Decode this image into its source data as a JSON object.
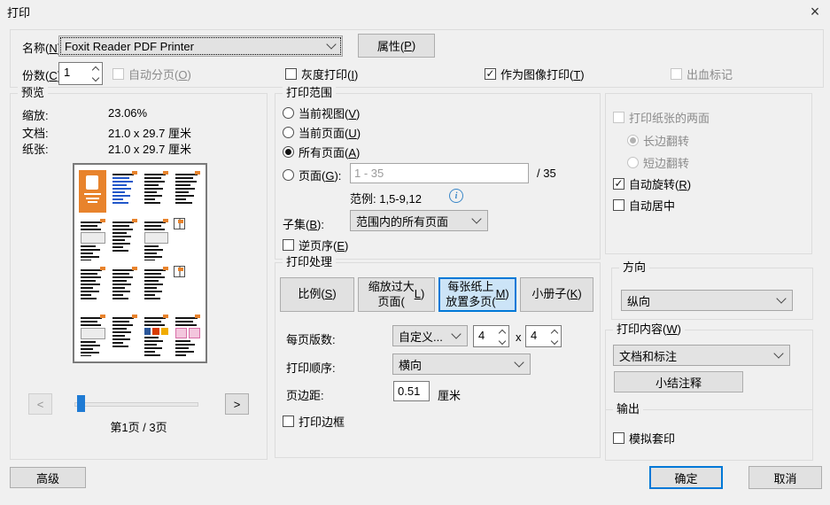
{
  "dialog": {
    "title": "打印",
    "close_icon": "×"
  },
  "printer_section": {
    "name_label": "名称(N):",
    "printer_name": "Foxit Reader PDF Printer",
    "properties_button": "属性(P)",
    "copies_label": "份数(C):",
    "copies_value": "1",
    "collate_checkbox": "自动分页(O)",
    "grayscale_checkbox": "灰度打印(I)",
    "print_as_image_checkbox": "作为图像打印(T)",
    "bleed_marks_checkbox": "出血标记"
  },
  "preview": {
    "group_title": "预览",
    "zoom_label": "缩放:",
    "zoom_value": "23.06%",
    "document_label": "文档:",
    "document_value": "21.0 x 29.7 厘米",
    "paper_label": "纸张:",
    "paper_value": "21.0 x 29.7 厘米",
    "prev_button": "<",
    "next_button": ">",
    "page_indicator": "第1页 / 3页",
    "thumbnail": {
      "rows": 4,
      "cols": 4,
      "cells": [
        "cover",
        "toc",
        "text",
        "text",
        "shot",
        "text",
        "shot",
        "box",
        "text",
        "text",
        "text",
        "box",
        "shot",
        "text",
        "word",
        "pics"
      ],
      "cover_color": "#e8832c"
    }
  },
  "print_range": {
    "group_title": "打印范围",
    "current_view_radio": "当前视图(V)",
    "current_page_radio": "当前页面(U)",
    "all_pages_radio": "所有页面(A)",
    "pages_radio": "页面(G):",
    "pages_value": "1 - 35",
    "pages_total": "/ 35",
    "example_text": "范例: 1,5-9,12",
    "info_icon": "i",
    "subset_label": "子集(B):",
    "subset_value": "范围内的所有页面",
    "reverse_checkbox": "逆页序(E)"
  },
  "print_handling": {
    "group_title": "打印处理",
    "scale_button": "比例(S)",
    "shrink_button": "缩放过大\n页面(L)",
    "multiple_button": "每张纸上\n放置多页(M)",
    "booklet_button": "小册子(K)",
    "pages_per_sheet_label": "每页版数:",
    "pages_per_sheet_value": "自定义...",
    "tiles_x": "4",
    "tiles_times": "x",
    "tiles_y": "4",
    "page_order_label": "打印顺序:",
    "page_order_value": "横向",
    "margin_label": "页边距:",
    "margin_value": "0.51",
    "margin_unit": "厘米",
    "print_border_checkbox": "打印边框"
  },
  "duplex": {
    "both_sides_checkbox": "打印纸张的两面",
    "flip_long_radio": "长边翻转",
    "flip_short_radio": "短边翻转",
    "auto_rotate_checkbox": "自动旋转(R)",
    "auto_center_checkbox": "自动居中"
  },
  "orientation": {
    "group_title": "方向",
    "value": "纵向"
  },
  "print_content": {
    "group_title": "打印内容(W)",
    "value": "文档和标注",
    "summarize_button": "小结注释"
  },
  "output": {
    "group_title": "输出",
    "simulate_checkbox": "模拟套印"
  },
  "footer": {
    "advanced_button": "高级",
    "ok_button": "确定",
    "cancel_button": "取消"
  },
  "colors": {
    "accent": "#0078d7",
    "selected_fill": "#cce4f7",
    "cover_orange": "#e8832c",
    "link_blue": "#2257c9"
  }
}
